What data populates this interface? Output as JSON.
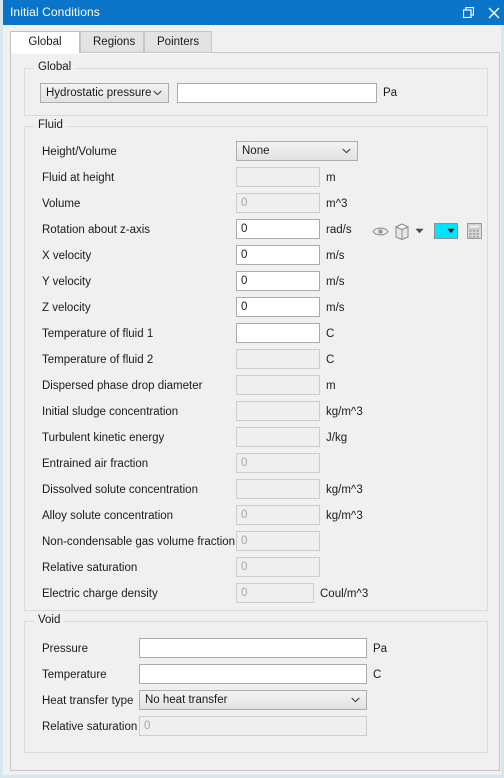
{
  "window": {
    "title": "Initial Conditions",
    "titlebar_color": "#0a74c8",
    "buttons": [
      {
        "name": "restore-button",
        "glyph": "restore"
      },
      {
        "name": "close-button",
        "glyph": "close"
      }
    ]
  },
  "tabs": [
    {
      "label": "Global",
      "active": true
    },
    {
      "label": "Regions",
      "active": false
    },
    {
      "label": "Pointers",
      "active": false
    }
  ],
  "global_group": {
    "title": "Global",
    "type_select": {
      "value": "Hydrostatic pressure",
      "options": [
        "Hydrostatic pressure"
      ]
    },
    "value_field": {
      "value": "",
      "placeholder": "",
      "enabled": true
    },
    "unit": "Pa"
  },
  "fluid_group": {
    "title": "Fluid",
    "height_volume": {
      "label": "Height/Volume",
      "value": "None",
      "options": [
        "None"
      ]
    },
    "toolbar_icons": [
      "eye-icon",
      "cube-icon",
      "chevron-down-icon",
      "color-swatch-icon",
      "grid-icon"
    ],
    "toolbar_swatch_color": "#00e5ff",
    "rows": [
      {
        "label": "Fluid at height",
        "value": "",
        "unit": "m",
        "enabled": false,
        "narrow": false
      },
      {
        "label": "Volume",
        "value": "0",
        "unit": "m^3",
        "enabled": false,
        "narrow": false
      },
      {
        "label": "Rotation about z-axis",
        "value": "0",
        "unit": "rad/s",
        "enabled": true,
        "narrow": false
      },
      {
        "label": "X velocity",
        "value": "0",
        "unit": "m/s",
        "enabled": true,
        "narrow": false
      },
      {
        "label": "Y velocity",
        "value": "0",
        "unit": "m/s",
        "enabled": true,
        "narrow": false
      },
      {
        "label": "Z velocity",
        "value": "0",
        "unit": "m/s",
        "enabled": true,
        "narrow": false
      },
      {
        "label": "Temperature of fluid 1",
        "value": "",
        "unit": "C",
        "enabled": true,
        "narrow": false
      },
      {
        "label": "Temperature of fluid 2",
        "value": "",
        "unit": "C",
        "enabled": false,
        "narrow": false
      },
      {
        "label": "Dispersed phase drop diameter",
        "value": "",
        "unit": "m",
        "enabled": false,
        "narrow": false
      },
      {
        "label": "Initial sludge concentration",
        "value": "",
        "unit": "kg/m^3",
        "enabled": false,
        "narrow": false
      },
      {
        "label": "Turbulent kinetic energy",
        "value": "",
        "unit": "J/kg",
        "enabled": false,
        "narrow": false
      },
      {
        "label": "Entrained air fraction",
        "value": "0",
        "unit": "",
        "enabled": false,
        "narrow": false
      },
      {
        "label": "Dissolved solute concentration",
        "value": "",
        "unit": "kg/m^3",
        "enabled": false,
        "narrow": false
      },
      {
        "label": "Alloy solute concentration",
        "value": "0",
        "unit": "kg/m^3",
        "enabled": false,
        "narrow": false
      },
      {
        "label": "Non-condensable gas volume fraction",
        "value": "0",
        "unit": "",
        "enabled": false,
        "narrow": false
      },
      {
        "label": "Relative saturation",
        "value": "0",
        "unit": "",
        "enabled": false,
        "narrow": false
      },
      {
        "label": "Electric charge density",
        "value": "0",
        "unit": "Coul/m^3",
        "enabled": false,
        "narrow": true
      }
    ]
  },
  "void_group": {
    "title": "Void",
    "rows": [
      {
        "label": "Pressure",
        "value": "",
        "unit": "Pa",
        "enabled": true,
        "kind": "field"
      },
      {
        "label": "Temperature",
        "value": "",
        "unit": "C",
        "enabled": true,
        "kind": "field"
      },
      {
        "label": "Heat transfer type",
        "value": "No heat transfer",
        "unit": "",
        "enabled": true,
        "kind": "combo",
        "options": [
          "No heat transfer"
        ]
      },
      {
        "label": "Relative saturation",
        "value": "0",
        "unit": "",
        "enabled": false,
        "kind": "field"
      }
    ]
  }
}
